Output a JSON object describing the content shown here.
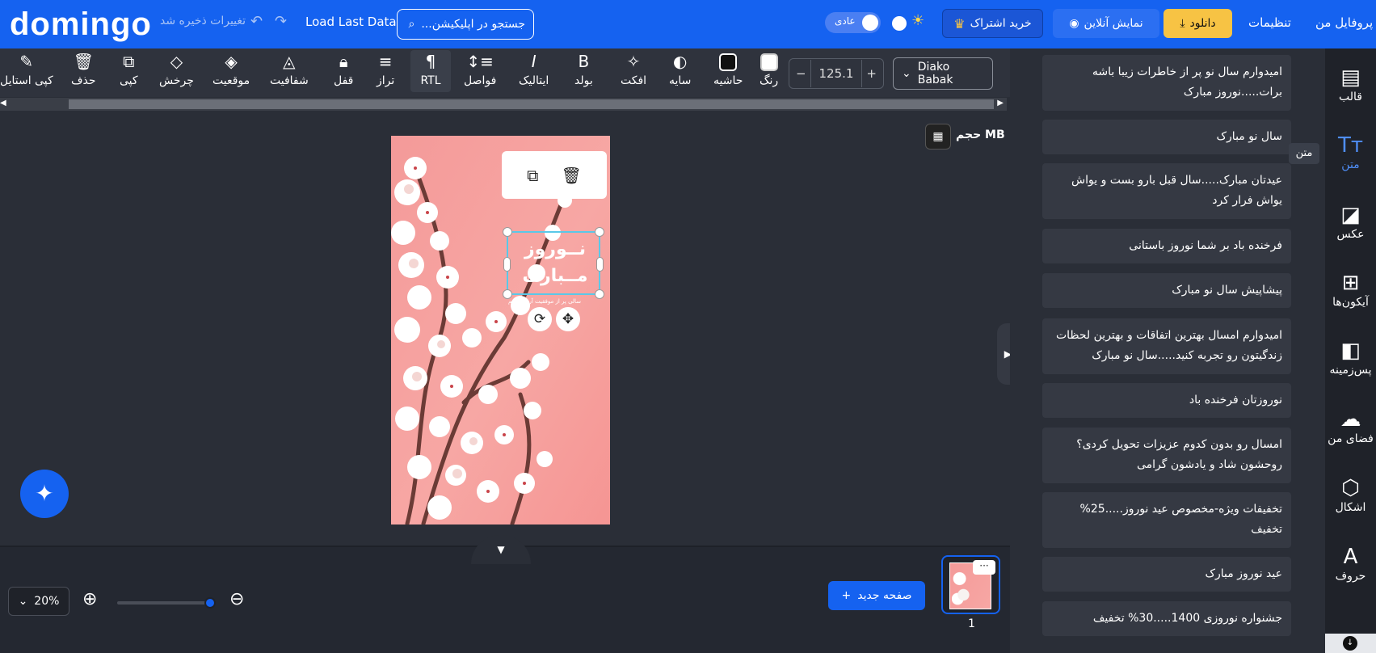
{
  "header": {
    "logo": "domingo",
    "unsaved": "تغییرات ذخیره شد",
    "load_last": "Load Last Data",
    "search_placeholder": "جستجو در اپلیکیشن...",
    "theme_label": "عادی",
    "subscribe": "خرید اشتراک",
    "online_demo": "نمایش آنلاین",
    "download": "دانلود",
    "settings": "تنظیمات",
    "profile": "پروفایل من"
  },
  "toolbar": {
    "copy_style": "کپی استایل",
    "delete": "حذف",
    "copy": "کپی",
    "rotate": "چرخش",
    "position": "موقعیت",
    "opacity": "شفافیت",
    "lock": "قفل",
    "align": "تراز",
    "rtl": "RTL",
    "spacing": "فواصل",
    "italic": "ایتالیک",
    "bold": "بولد",
    "effect": "افکت",
    "shadow": "سایه",
    "border": "حاشیه",
    "color": "رنگ",
    "font_size": "125.1",
    "font_name": "Diako Babak",
    "border_color": "#111111",
    "text_color": "#ffffff"
  },
  "workspace": {
    "size_label": "حجم MB"
  },
  "canvas": {
    "title_line1": "نــوروز",
    "title_line2": "مــبارک",
    "subtitle": "سالی پر از موفقیت آرزو میکنم"
  },
  "bottom": {
    "zoom": "20%",
    "new_page": "صفحه جدید",
    "page_number": "1"
  },
  "panel": {
    "cards": [
      "امیدوارم سال نو پر از خاطرات زیبا باشه برات.....نوروز مبارک",
      "سال نو مبارک",
      "عیدتان مبارک.....سال قبل بارو بست و یواش یواش فرار کرد",
      "فرخنده باد بر شما نوروز باستانی",
      "پیشاپیش سال نو مبارک",
      "امیدوارم امسال بهترین اتفاقات و بهترین لحظات زندگیتون رو تجربه کنید.....سال نو مبارک",
      "نوروزتان فرخنده باد",
      "امسال رو بدون کدوم عزیزات تحویل کردی؟ روحشون شاد و یادشون گرامی",
      "تخفیفات ویژه-مخصوص عید نوروز.....25% تخفیف",
      "عید نوروز مبارک",
      "جشنواره نوروزی 1400.....30% تخفیف"
    ]
  },
  "rail": {
    "template": "قالب",
    "text": "متن",
    "image": "عکس",
    "icons": "آیکون‌ها",
    "background": "پس‌زمینه",
    "my_space": "فضای من",
    "shapes": "اشکال",
    "letters": "حروف",
    "tooltip": "متن"
  },
  "colors": {
    "brand": "#1562f0",
    "accent": "#f7c344"
  }
}
